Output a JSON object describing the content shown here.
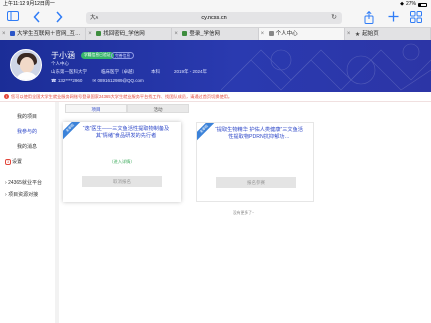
{
  "status_bar": {
    "time": "上午11:12",
    "date": "9月12日周一",
    "signal": "◆",
    "battery_pct": "27%",
    "battery_fill": 0.27
  },
  "browser": {
    "url_prefix": "大ᴀ",
    "url_host": "cy.ncss.cn",
    "tabs": [
      {
        "label": "大学生互联网＋官网_互…",
        "fav_color": "#2b55c7"
      },
      {
        "label": "找回密码_学信网",
        "fav_color": "#3e8d3e"
      },
      {
        "label": "登录_学信网",
        "fav_color": "#3e8d3e"
      },
      {
        "label": "个人中心",
        "fav_color": "#888888"
      },
      {
        "label": "起始页",
        "fav_color": "#444444"
      }
    ]
  },
  "profile": {
    "name": "于小涵",
    "badge_verified": "学籍信息已验证",
    "badge_edit": "完善信息",
    "type": "个人中心",
    "school": "山东第一医科大学",
    "major": "临床医学（卓越）",
    "degree": "本科",
    "years": "2019年 - 2024年",
    "phone": "132****2960",
    "email": "0891612989@QQ.com"
  },
  "notice": {
    "text": "您可以使用全国大学生就业服务网账号登录国家24365大学生就业服务平台找工作、找团队成员，请通过首页切换使用。"
  },
  "sidebar": {
    "items": [
      {
        "label": "我的项目"
      },
      {
        "label": "我参与的"
      },
      {
        "label": "我的消息"
      },
      {
        "mark": "3",
        "label": "设置"
      }
    ],
    "links": [
      {
        "label": "24365就业平台"
      },
      {
        "label": "项目资源对接"
      }
    ]
  },
  "main": {
    "subtabs": [
      "项目",
      "活动"
    ],
    "cards": [
      {
        "ribbon": "未审核",
        "title": "“逸”医生——三文鱼活性提取物制备及其“情绪”食品研发的先行者",
        "status": "（进入详情）",
        "button": "取消报名"
      },
      {
        "ribbon": "未审核",
        "title": "“提取生物精华 护佑人类健康”三文鱼活性提取物PDRN抗抑郁功…",
        "status": "",
        "button": "报名参赛"
      }
    ],
    "more": "没有更多了~"
  }
}
